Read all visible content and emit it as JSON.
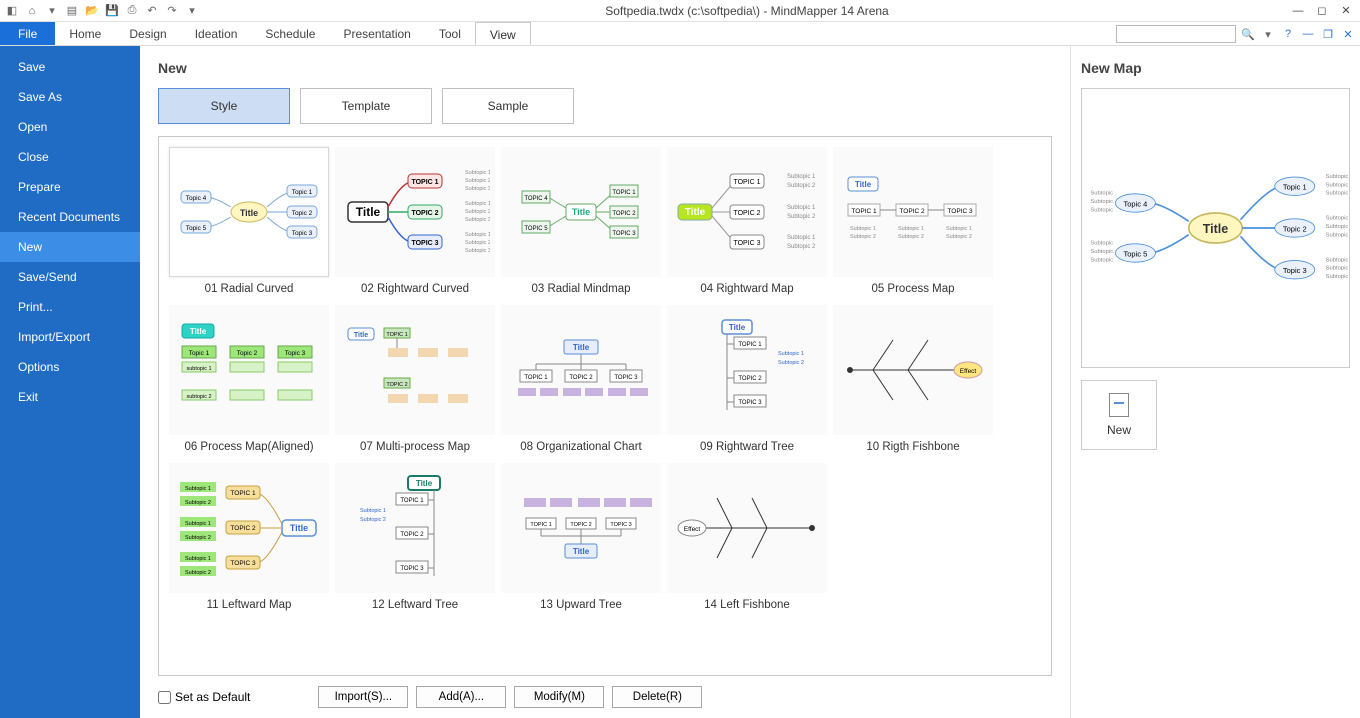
{
  "titlebar": {
    "title": "Softpedia.twdx (c:\\softpedia\\) - MindMapper 14 Arena"
  },
  "ribbon": {
    "tabs": [
      "File",
      "Home",
      "Design",
      "Ideation",
      "Schedule",
      "Presentation",
      "Tool",
      "View"
    ],
    "active": "View",
    "file": "File"
  },
  "sidebar": {
    "items": [
      "Save",
      "Save As",
      "Open",
      "Close",
      "Prepare",
      "Recent Documents",
      "New",
      "Save/Send",
      "Print...",
      "Import/Export",
      "Options",
      "Exit"
    ],
    "selected": "New"
  },
  "page": {
    "heading": "New",
    "tabs": {
      "style": "Style",
      "template": "Template",
      "sample": "Sample"
    }
  },
  "gallery": [
    {
      "label": "01 Radial Curved"
    },
    {
      "label": "02 Rightward Curved"
    },
    {
      "label": "03 Radial Mindmap"
    },
    {
      "label": "04 Rightward Map"
    },
    {
      "label": "05 Process Map"
    },
    {
      "label": "06 Process Map(Aligned)"
    },
    {
      "label": "07 Multi-process Map"
    },
    {
      "label": "08 Organizational Chart"
    },
    {
      "label": "09 Rightward Tree"
    },
    {
      "label": "10 Rigth Fishbone"
    },
    {
      "label": "11 Leftward Map"
    },
    {
      "label": "12 Leftward Tree"
    },
    {
      "label": "13 Upward Tree"
    },
    {
      "label": "14 Left Fishbone"
    }
  ],
  "bottom": {
    "set_default": "Set as Default",
    "import": "Import(S)...",
    "add": "Add(A)...",
    "modify": "Modify(M)",
    "delete": "Delete(R)"
  },
  "preview": {
    "heading": "New Map",
    "new_label": "New"
  },
  "sample": {
    "title": "Title",
    "topic1": "Topic 1",
    "topic2": "Topic 2",
    "topic3": "Topic 3",
    "topic4": "Topic 4",
    "topic5": "Topic 5",
    "tOPIC1": "TOPIC 1",
    "tOPIC2": "TOPIC 2",
    "tOPIC3": "TOPIC 3",
    "subtopic": "Subtopic",
    "subtopic1": "Subtopic 1",
    "subtopic2": "Subtopic 2",
    "subtopic3": "Subtopic 3",
    "pc_topic1": "Topic 1",
    "pc_topic2": "Topic 2",
    "pc_topic3": "Topic 3",
    "effect": "Effect"
  }
}
